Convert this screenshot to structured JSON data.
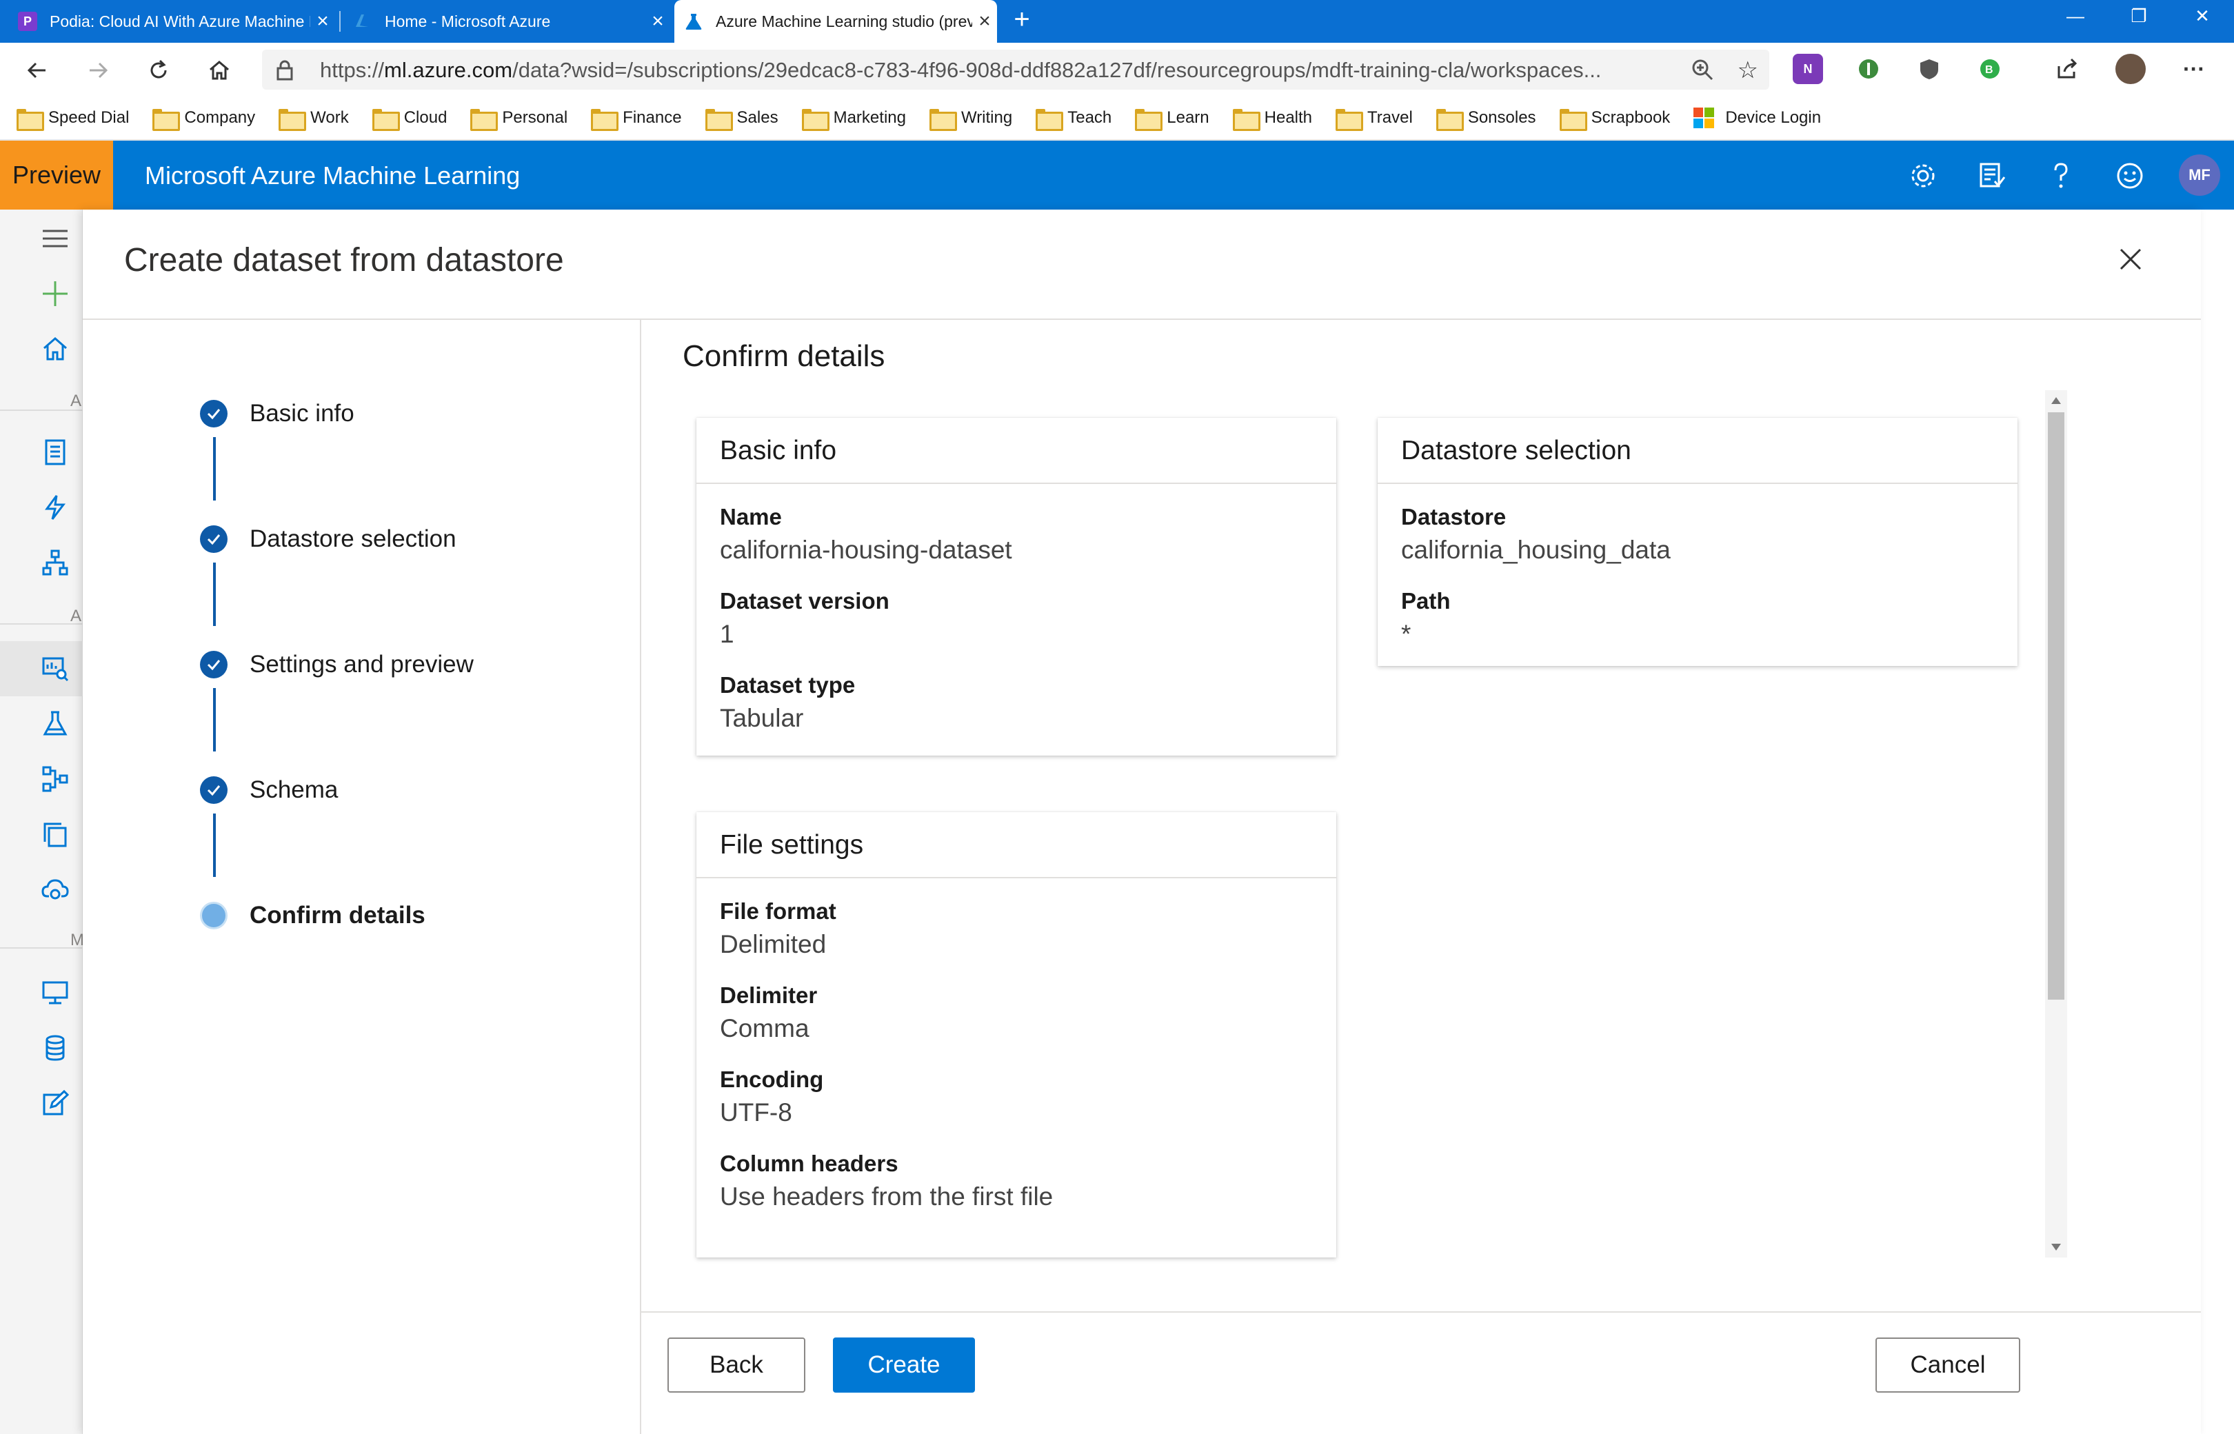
{
  "browser": {
    "tabs": [
      {
        "title": "Podia: Cloud AI With Azure Machine Learning",
        "favicon": "P",
        "favicon_color": "#7a3ccf"
      },
      {
        "title": "Home - Microsoft Azure",
        "favicon": "azure-icon",
        "favicon_color": "#0a6fd2"
      },
      {
        "title": "Azure Machine Learning studio (preview)",
        "favicon": "flask-icon",
        "favicon_color": "#0078d4"
      }
    ],
    "url_prefix": "https://",
    "url_host": "ml.azure.com",
    "url_rest": "/data?wsid=/subscriptions/29edcac8-c783-4f96-908d-ddf882a127df/resourcegroups/mdft-training-cla/workspaces...",
    "bookmarks": [
      "Speed Dial",
      "Company",
      "Work",
      "Cloud",
      "Personal",
      "Finance",
      "Sales",
      "Marketing",
      "Writing",
      "Teach",
      "Learn",
      "Health",
      "Travel",
      "Sonsoles",
      "Scrapbook"
    ],
    "device_login": "Device Login"
  },
  "app": {
    "preview_label": "Preview",
    "name": "Microsoft Azure Machine Learning",
    "avatar_initials": "MF",
    "accent": "#0078d4",
    "preview_color": "#f7941d"
  },
  "rail": {
    "letters": [
      "A",
      "A",
      "M"
    ]
  },
  "panel": {
    "title": "Create dataset from datastore",
    "steps": [
      {
        "label": "Basic info",
        "state": "complete"
      },
      {
        "label": "Datastore selection",
        "state": "complete"
      },
      {
        "label": "Settings and preview",
        "state": "complete"
      },
      {
        "label": "Schema",
        "state": "complete"
      },
      {
        "label": "Confirm details",
        "state": "current"
      }
    ],
    "content_title": "Confirm details",
    "basic_info": {
      "heading": "Basic info",
      "fields": [
        {
          "label": "Name",
          "value": "california-housing-dataset"
        },
        {
          "label": "Dataset version",
          "value": "1"
        },
        {
          "label": "Dataset type",
          "value": "Tabular"
        }
      ]
    },
    "datastore_selection": {
      "heading": "Datastore selection",
      "fields": [
        {
          "label": "Datastore",
          "value": "california_housing_data"
        },
        {
          "label": "Path",
          "value": "*"
        }
      ]
    },
    "file_settings": {
      "heading": "File settings",
      "fields": [
        {
          "label": "File format",
          "value": "Delimited"
        },
        {
          "label": "Delimiter",
          "value": "Comma"
        },
        {
          "label": "Encoding",
          "value": "UTF-8"
        },
        {
          "label": "Column headers",
          "value": "Use headers from the first file"
        }
      ]
    },
    "buttons": {
      "back": "Back",
      "create": "Create",
      "cancel": "Cancel"
    }
  }
}
